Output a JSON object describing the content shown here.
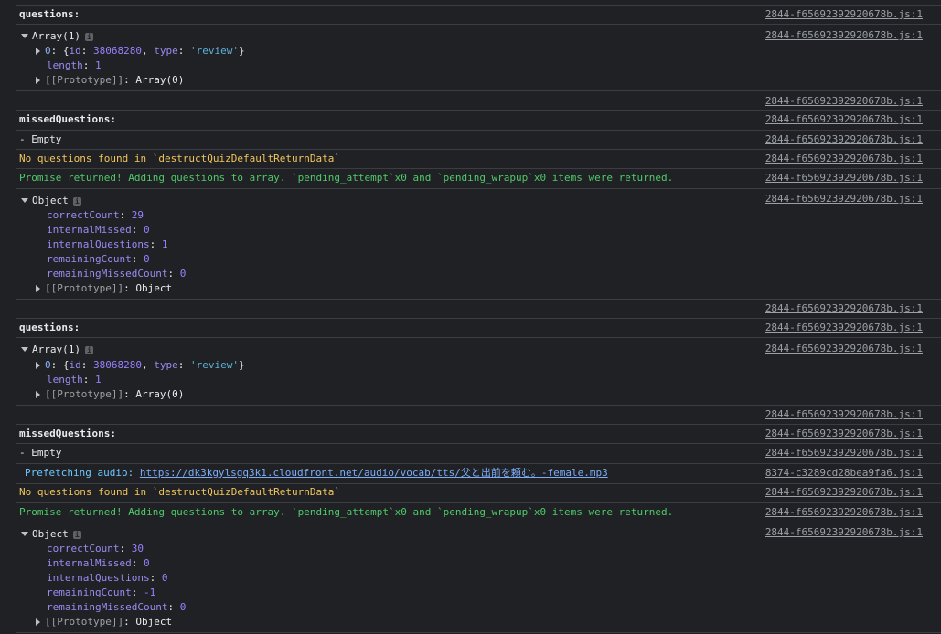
{
  "source_main": "2844-f65692392920678b.js:1",
  "source_audio": "8374-c3289cd28bea9fa6.js:1",
  "info_glyph": "i",
  "labels": {
    "questions": "questions:",
    "missed": "missedQuestions:",
    "empty": "- Empty",
    "no_questions": "No questions found in `destructQuizDefaultReturnData`",
    "promise": "Promise returned! Adding questions to array. `pending_attempt`x0 and `pending_wrapup`x0 items were returned.",
    "prefetch_prefix": "Prefetching audio: ",
    "prefetch_url": "https://dk3kgylsgq3k1.cloudfront.net/audio/vocab/tts/父と出前を頼む。-female.mp3"
  },
  "array_block": {
    "header": "Array(1)",
    "item_index": "0",
    "item_prefix": ": {",
    "id_key": "id",
    "id_value": "38068280",
    "type_key": "type",
    "type_value": "'review'",
    "item_suffix": "}",
    "length_key": "length",
    "length_value": "1",
    "proto_key": "[[Prototype]]",
    "proto_value": "Array(0)"
  },
  "object_block_1": {
    "header": "Object",
    "props": [
      {
        "key": "correctCount",
        "value": "29"
      },
      {
        "key": "internalMissed",
        "value": "0"
      },
      {
        "key": "internalQuestions",
        "value": "1"
      },
      {
        "key": "remainingCount",
        "value": "0"
      },
      {
        "key": "remainingMissedCount",
        "value": "0"
      }
    ],
    "proto_key": "[[Prototype]]",
    "proto_value": "Object"
  },
  "object_block_2": {
    "header": "Object",
    "props": [
      {
        "key": "correctCount",
        "value": "30"
      },
      {
        "key": "internalMissed",
        "value": "0"
      },
      {
        "key": "internalQuestions",
        "value": "0"
      },
      {
        "key": "remainingCount",
        "value": "-1"
      },
      {
        "key": "remainingMissedCount",
        "value": "0"
      }
    ],
    "proto_key": "[[Prototype]]",
    "proto_value": "Object"
  },
  "colors": {
    "background": "#202124",
    "warning_yellow": "#f2c55c",
    "success_green": "#4eca69",
    "info_blue": "#6ec6ff",
    "link_blue": "#7cacf8"
  }
}
